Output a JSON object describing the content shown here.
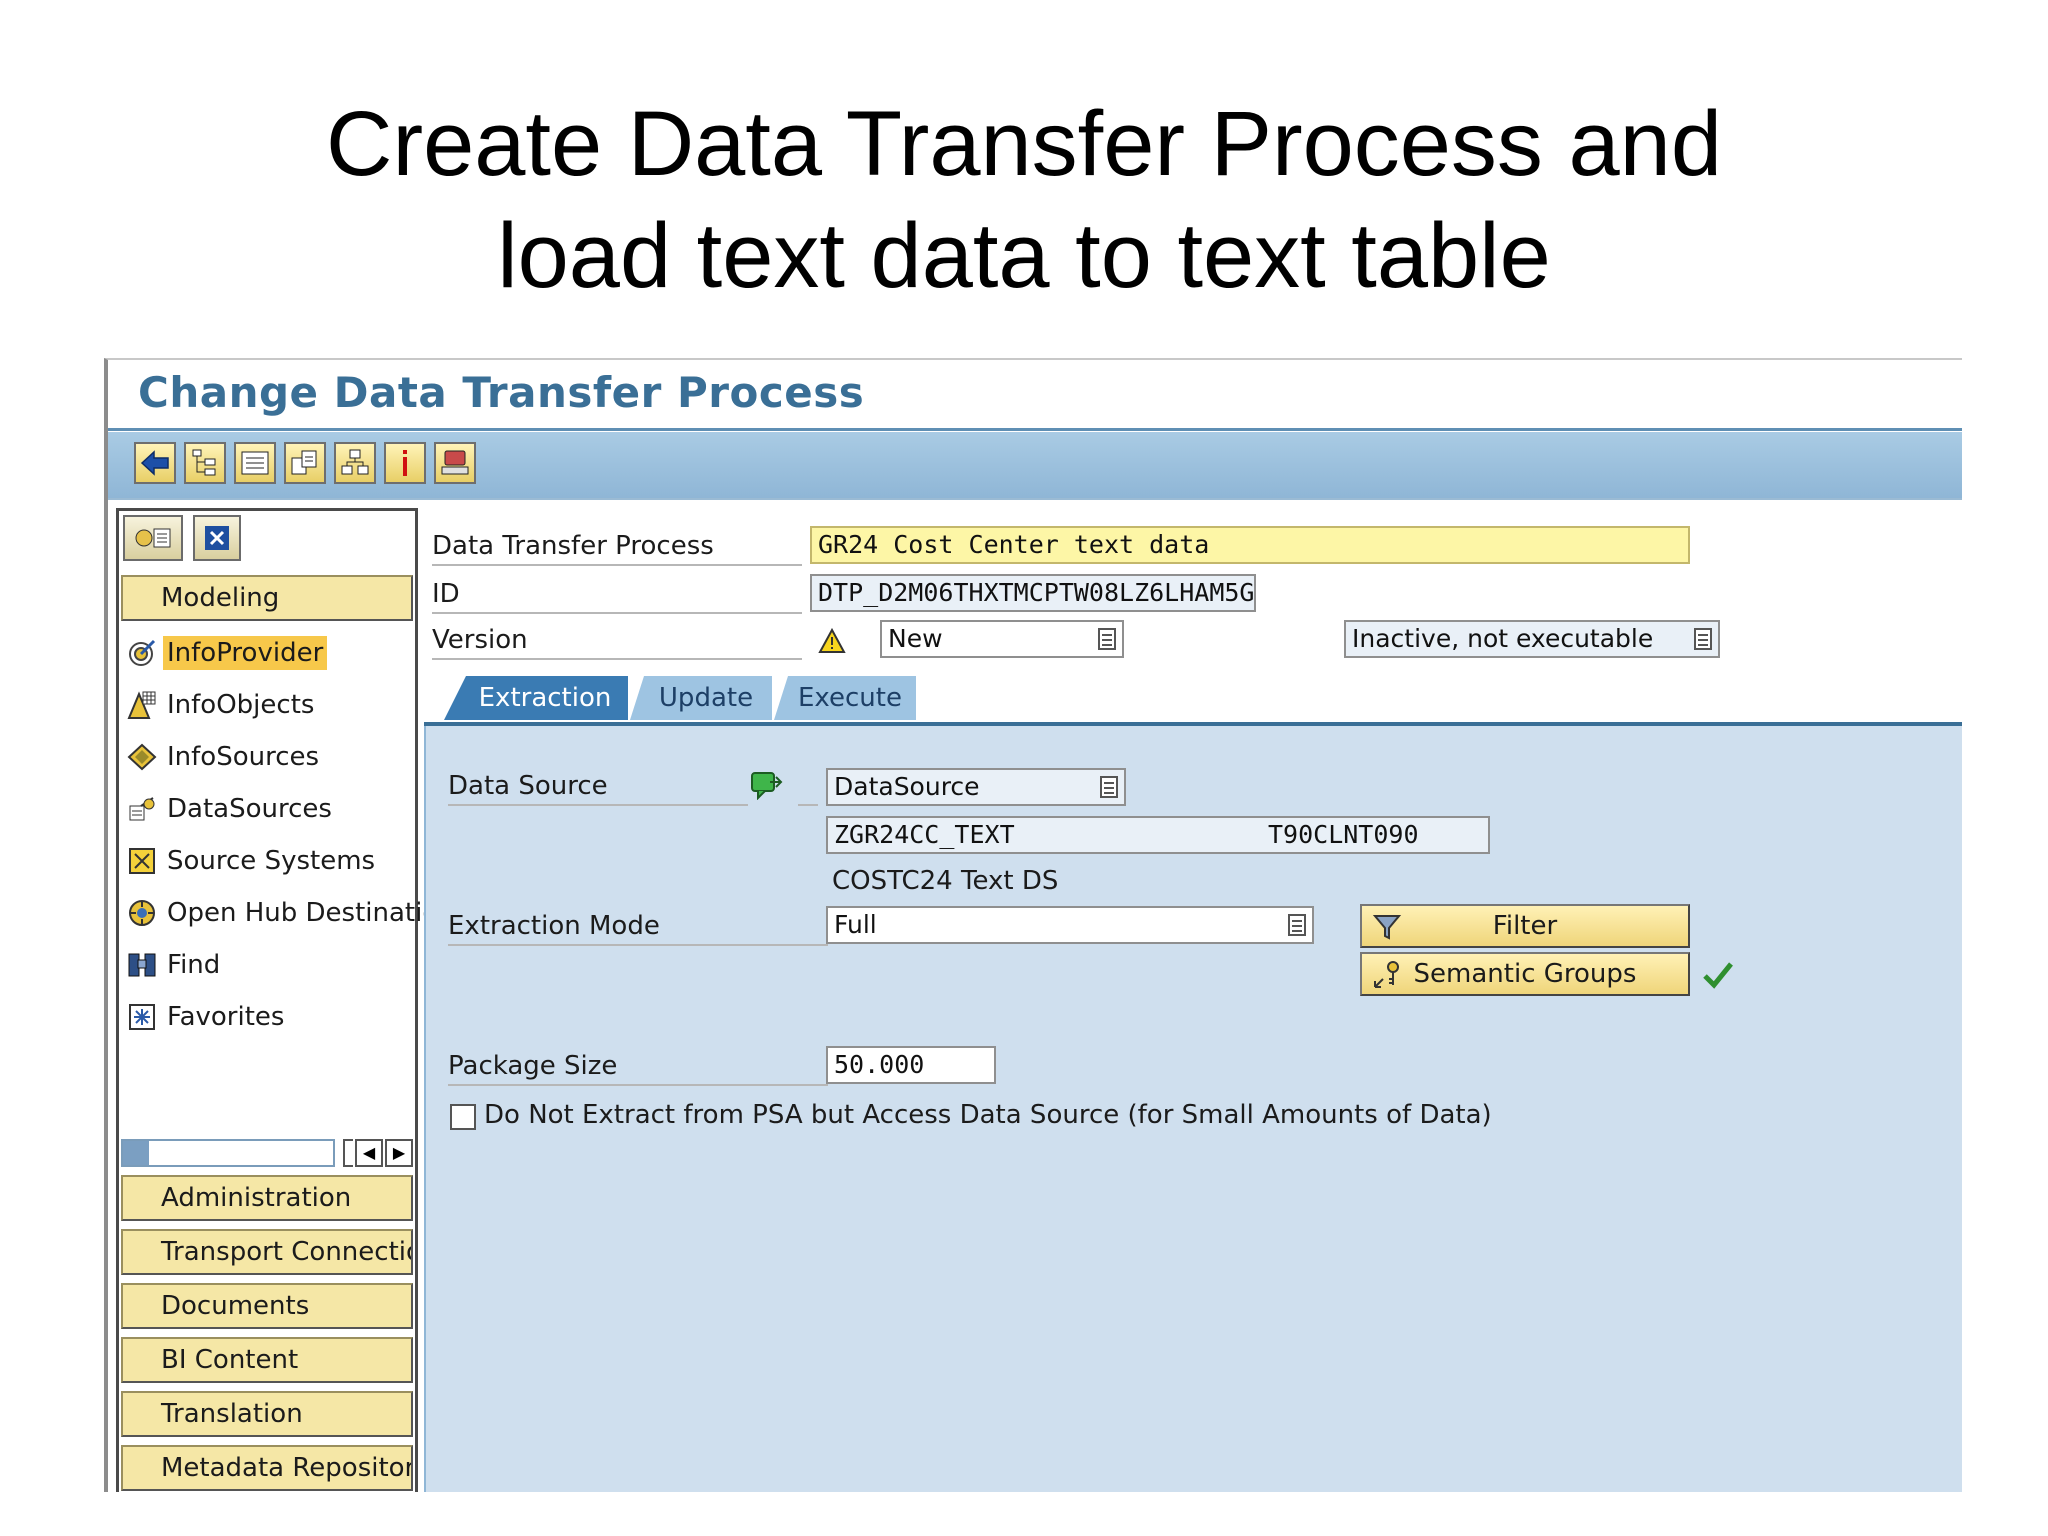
{
  "slide": {
    "title_line1": "Create Data Transfer Process and",
    "title_line2": "load text data to text table"
  },
  "window": {
    "title": "Change Data Transfer Process"
  },
  "toolbar": {
    "buttons": [
      "back-arrow-icon",
      "hierarchy-icon",
      "list-icon",
      "copy-object-icon",
      "tree-icon",
      "info-icon",
      "display-icon"
    ]
  },
  "sidebar": {
    "sections_top": [
      "Modeling"
    ],
    "items": [
      {
        "label": "InfoProvider",
        "icon": "target-icon",
        "selected": true
      },
      {
        "label": "InfoObjects",
        "icon": "infoobject-icon"
      },
      {
        "label": "InfoSources",
        "icon": "infosource-icon"
      },
      {
        "label": "DataSources",
        "icon": "datasource-icon"
      },
      {
        "label": "Source Systems",
        "icon": "source-system-icon"
      },
      {
        "label": "Open Hub Destination",
        "icon": "open-hub-icon"
      },
      {
        "label": "Find",
        "icon": "binoculars-icon"
      },
      {
        "label": "Favorites",
        "icon": "favorites-icon"
      }
    ],
    "sections_bottom": [
      "Administration",
      "Transport Connection",
      "Documents",
      "BI Content",
      "Translation",
      "Metadata Repository"
    ]
  },
  "form": {
    "dtp_label": "Data Transfer Process",
    "dtp_value": "GR24 Cost Center text data",
    "id_label": "ID",
    "id_value": "DTP_D2M06THXTMCPTW08LZ6LHAM5G",
    "version_label": "Version",
    "version_value": "New",
    "status_value": "Inactive, not executable"
  },
  "tabs": [
    {
      "label": "Extraction",
      "active": true
    },
    {
      "label": "Update",
      "active": false
    },
    {
      "label": "Execute",
      "active": false
    }
  ],
  "extraction": {
    "data_source_label": "Data Source",
    "data_source_type": "DataSource",
    "datasource_name": "ZGR24CC_TEXT",
    "source_system": "T90CLNT090",
    "datasource_desc": "COSTC24 Text DS",
    "extraction_mode_label": "Extraction Mode",
    "extraction_mode_value": "Full",
    "filter_label": "Filter",
    "semantic_groups_label": "Semantic Groups",
    "package_size_label": "Package Size",
    "package_size_value": "50.000",
    "psa_checkbox_label": "Do Not Extract from PSA but Access Data Source (for Small Amounts of Data)",
    "psa_checked": false
  },
  "colors": {
    "title_blue": "#3a6f96",
    "toolbar": "#a9cbe4",
    "panel": "#cfdfee",
    "section": "#f5e7a6",
    "highlight": "#fdf6a6",
    "selected": "#f7c84a"
  }
}
